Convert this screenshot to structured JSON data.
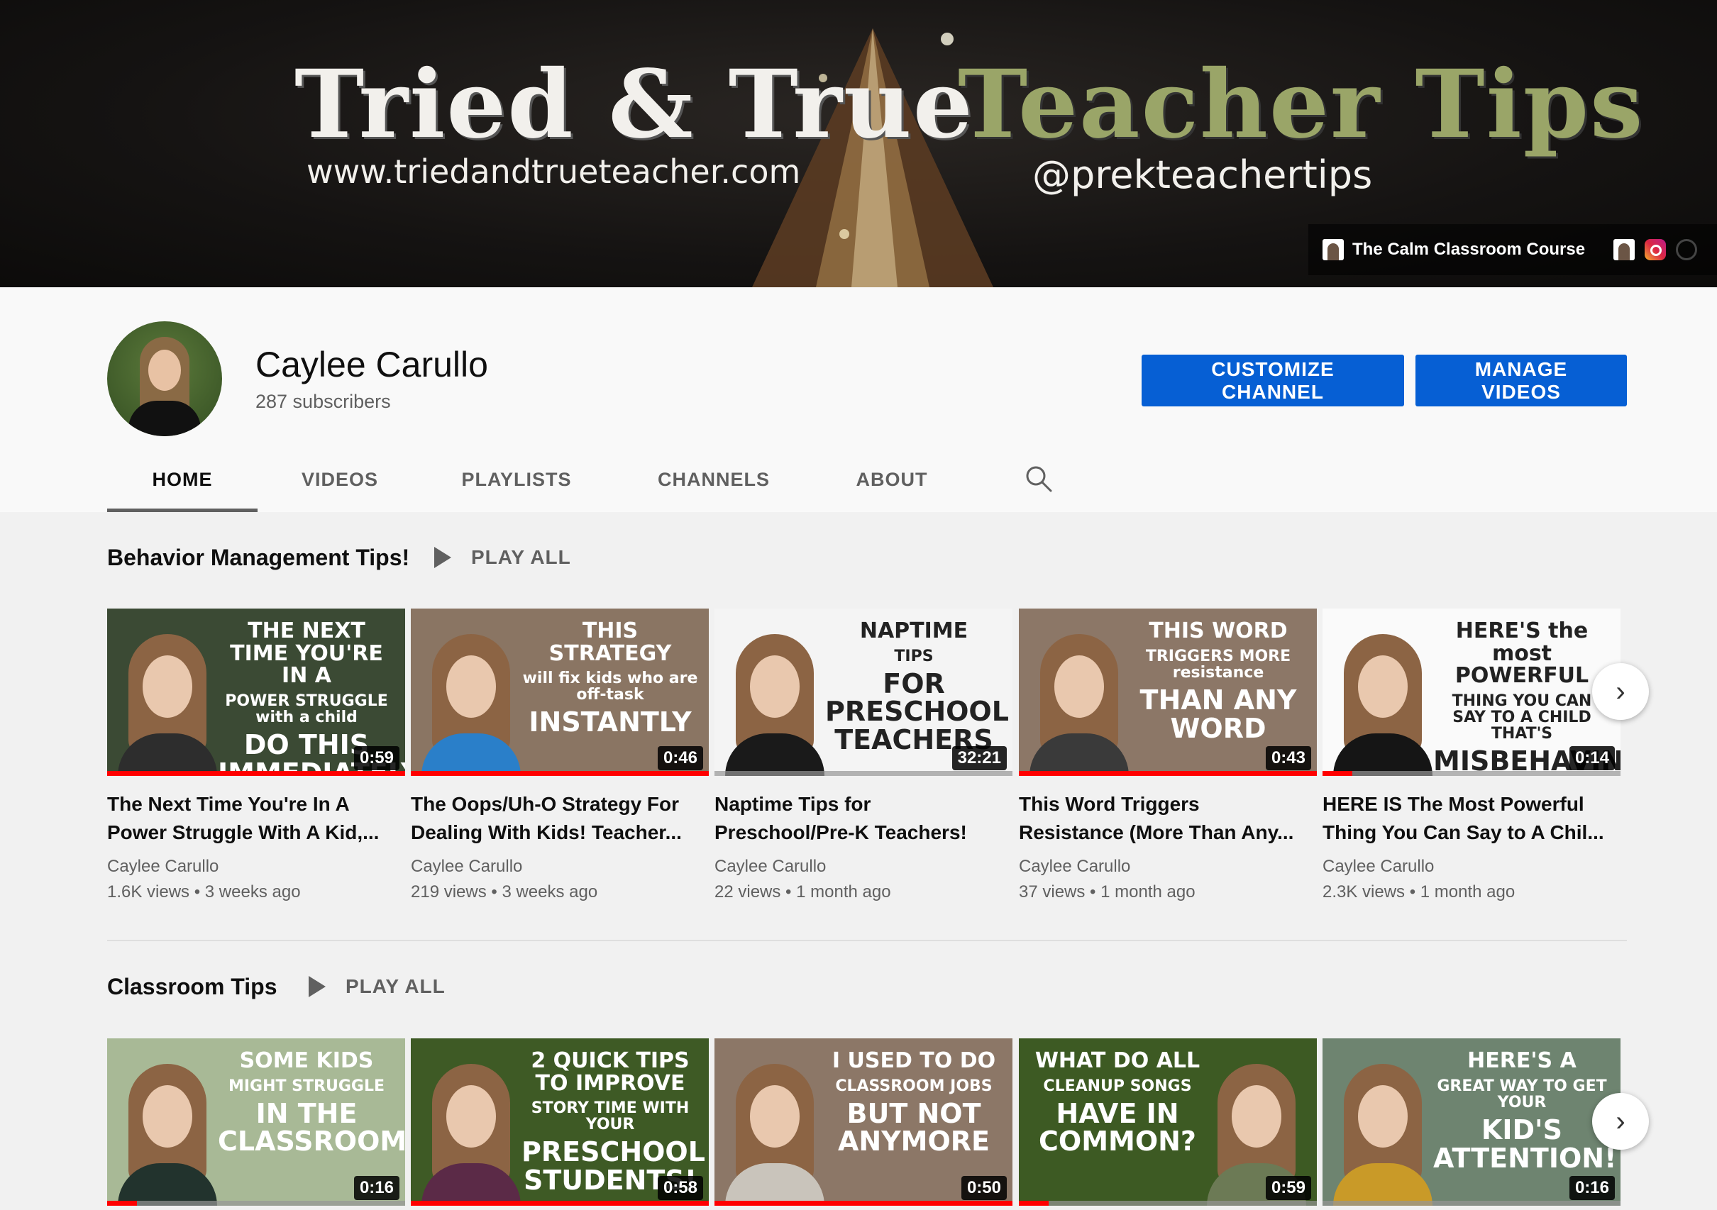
{
  "banner": {
    "title_left": "Tried & True",
    "title_right": "Teacher Tips",
    "url": "www.triedandtrueteacher.com",
    "handle": "@prekteachertips",
    "link_label": "The Calm Classroom Course"
  },
  "channel": {
    "name": "Caylee Carullo",
    "subscribers": "287 subscribers",
    "customize_label": "CUSTOMIZE CHANNEL",
    "manage_label": "MANAGE VIDEOS"
  },
  "tabs": [
    "HOME",
    "VIDEOS",
    "PLAYLISTS",
    "CHANNELS",
    "ABOUT"
  ],
  "active_tab": "HOME",
  "shelves": [
    {
      "title": "Behavior Management Tips!",
      "play_all": "PLAY ALL",
      "videos": [
        {
          "title_line1": "The Next Time You're In A",
          "title_line2": "Power Struggle With A Kid,...",
          "channel": "Caylee Carullo",
          "meta": "1.6K views • 3 weeks ago",
          "duration": "0:59",
          "thumb_line1": "THE NEXT TIME YOU'RE IN A",
          "thumb_line2": "POWER STRUGGLE with a child",
          "thumb_line3": "DO THIS IMMEDIATELY",
          "progress": 1.0,
          "bg": "#3b4a34",
          "fg": "#ffffff",
          "shirt": "#2d2d2d"
        },
        {
          "title_line1": "The Oops/Uh-O Strategy For",
          "title_line2": "Dealing With Kids! Teacher...",
          "channel": "Caylee Carullo",
          "meta": "219 views • 3 weeks ago",
          "duration": "0:46",
          "thumb_line1": "THIS STRATEGY",
          "thumb_line2": "will fix kids who are off-task",
          "thumb_line3": "INSTANTLY",
          "progress": 1.0,
          "bg": "#8a7563",
          "fg": "#ffffff",
          "shirt": "#2a7fc9"
        },
        {
          "title_line1": "Naptime Tips for",
          "title_line2": "Preschool/Pre-K Teachers!",
          "channel": "Caylee Carullo",
          "meta": "22 views • 1 month ago",
          "duration": "32:21",
          "thumb_line1": "NAPTIME",
          "thumb_line2": "TIPS",
          "thumb_line3": "FOR PRESCHOOL TEACHERS",
          "progress": 0.0,
          "bg": "#f4f4f4",
          "fg": "#222222",
          "shirt": "#1a1a1a"
        },
        {
          "title_line1": "This Word Triggers",
          "title_line2": "Resistance (More Than Any...",
          "channel": "Caylee Carullo",
          "meta": "37 views • 1 month ago",
          "duration": "0:43",
          "thumb_line1": "THIS WORD",
          "thumb_line2": "TRIGGERS MORE resistance",
          "thumb_line3": "THAN ANY WORD",
          "progress": 1.0,
          "bg": "#8c7767",
          "fg": "#ffffff",
          "shirt": "#3a3a3a"
        },
        {
          "title_line1": "HERE IS The Most Powerful",
          "title_line2": "Thing You Can Say to A Chil...",
          "channel": "Caylee Carullo",
          "meta": "2.3K views • 1 month ago",
          "duration": "0:14",
          "thumb_line1": "HERE'S the most POWERFUL",
          "thumb_line2": "THING YOU CAN SAY TO A CHILD THAT'S",
          "thumb_line3": "MISBEHAVING...",
          "progress": 0.1,
          "bg": "#fafafa",
          "fg": "#222222",
          "shirt": "#151515"
        }
      ]
    },
    {
      "title": "Classroom Tips",
      "play_all": "PLAY ALL",
      "videos": [
        {
          "duration": "0:16",
          "thumb_line1": "SOME KIDS",
          "thumb_line2": "MIGHT STRUGGLE",
          "thumb_line3": "IN THE CLASSROOM...",
          "progress": 0.1,
          "bg": "#a8b996",
          "fg": "#ffffff",
          "shirt": "#22332d"
        },
        {
          "duration": "0:58",
          "thumb_line1": "2 QUICK TIPS TO IMPROVE",
          "thumb_line2": "STORY TIME WITH YOUR",
          "thumb_line3": "PRESCHOOL STUDENTS!",
          "progress": 1.0,
          "bg": "#3e5a25",
          "fg": "#ffffff",
          "shirt": "#5b2a47"
        },
        {
          "duration": "0:50",
          "thumb_line1": "I USED TO DO",
          "thumb_line2": "CLASSROOM JOBS",
          "thumb_line3": "BUT NOT ANYMORE",
          "progress": 1.0,
          "bg": "#8c7767",
          "fg": "#ffffff",
          "shirt": "#c9c4bb"
        },
        {
          "duration": "0:59",
          "thumb_line1": "WHAT DO ALL",
          "thumb_line2": "CLEANUP SONGS",
          "thumb_line3": "HAVE IN COMMON?",
          "progress": 0.1,
          "bg": "#3d5a23",
          "fg": "#ffffff",
          "shirt": "#6c7a55"
        },
        {
          "duration": "0:16",
          "thumb_line1": "HERE'S A",
          "thumb_line2": "GREAT WAY TO GET YOUR",
          "thumb_line3": "KID'S ATTENTION!",
          "progress": 0.0,
          "bg": "#6e8470",
          "fg": "#ffffff",
          "shirt": "#c99a28"
        }
      ]
    }
  ],
  "colors": {
    "accent": "#065fd4",
    "progress": "#ff0000",
    "text_secondary": "#606060"
  },
  "icons": [
    "search-icon",
    "play-icon",
    "chevron-right-icon",
    "instagram-icon",
    "globe-icon"
  ]
}
